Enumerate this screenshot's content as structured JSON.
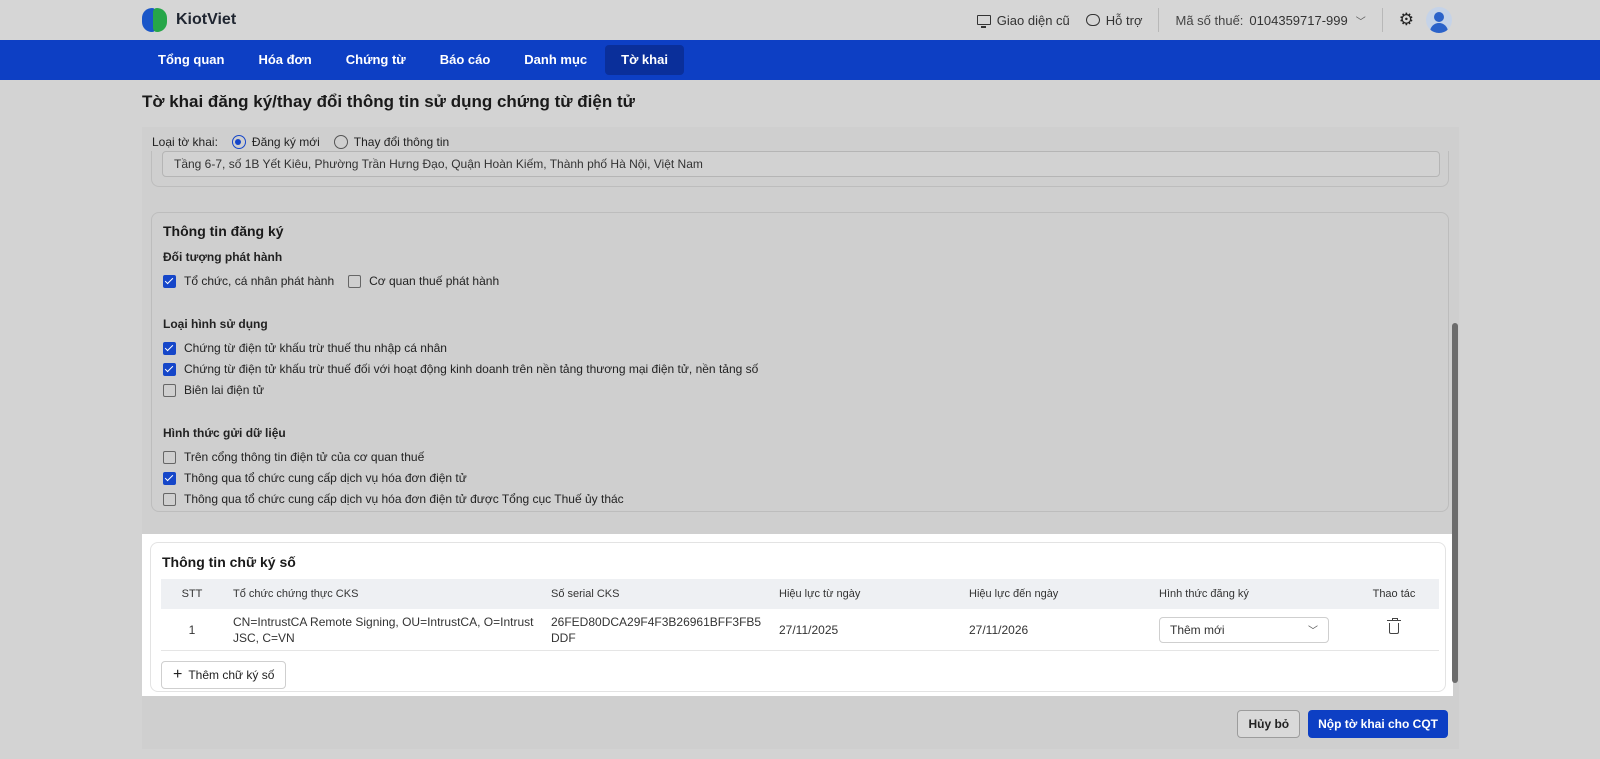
{
  "app": {
    "logo_text": "KiotViet"
  },
  "topbar": {
    "old_ui_label": "Giao diện cũ",
    "support_label": "Hỗ trợ",
    "tax_code_label": "Mã số thuế:",
    "tax_code_value": "0104359717-999"
  },
  "nav": {
    "items": [
      "Tổng quan",
      "Hóa đơn",
      "Chứng từ",
      "Báo cáo",
      "Danh mục",
      "Tờ khai"
    ],
    "active": "Tờ khai"
  },
  "page": {
    "title": "Tờ khai đăng ký/thay đổi thông tin sử dụng chứng từ điện tử"
  },
  "form": {
    "type_label": "Loại tờ khai:",
    "type_options": [
      "Đăng ký mới",
      "Thay đổi thông tin"
    ],
    "type_selected": "Đăng ký mới",
    "address_value": "Tầng 6-7, số 1B Yết Kiêu, Phường Trần Hưng Đạo, Quận Hoàn Kiếm, Thành phố Hà Nội, Việt Nam"
  },
  "registration": {
    "title": "Thông tin đăng ký",
    "issuer": {
      "title": "Đối tượng phát hành",
      "options": [
        {
          "label": "Tổ chức, cá nhân phát hành",
          "checked": true
        },
        {
          "label": "Cơ quan thuế phát hành",
          "checked": false
        }
      ]
    },
    "usage": {
      "title": "Loại hình sử dụng",
      "options": [
        {
          "label": "Chứng từ điện tử khấu trừ thuế thu nhập cá nhân",
          "checked": true
        },
        {
          "label": "Chứng từ điện tử khấu trừ thuế đối với hoạt động kinh doanh trên nền tảng thương mại điện tử, nền tảng số",
          "checked": true
        },
        {
          "label": "Biên lai điện tử",
          "checked": false
        }
      ]
    },
    "send": {
      "title": "Hình thức gửi dữ liệu",
      "options": [
        {
          "label": "Trên cổng thông tin điện tử của cơ quan thuế",
          "checked": false
        },
        {
          "label": "Thông qua tổ chức cung cấp dịch vụ hóa đơn điện tử",
          "checked": true
        },
        {
          "label": "Thông qua tổ chức cung cấp dịch vụ hóa đơn điện tử được Tổng cục Thuế ủy thác",
          "checked": false
        }
      ]
    }
  },
  "signature": {
    "title": "Thông tin chữ ký số",
    "columns": [
      "STT",
      "Tổ chức chứng thực CKS",
      "Số serial CKS",
      "Hiệu lực từ ngày",
      "Hiệu lực đến ngày",
      "Hình thức đăng ký",
      "Thao tác"
    ],
    "rows": [
      {
        "stt": "1",
        "org": "CN=IntrustCA Remote Signing, OU=IntrustCA, O=Intrust JSC, C=VN",
        "serial": "26FED80DCA29F4F3B26961BFF3FB5DDF",
        "from": "27/11/2025",
        "to": "27/11/2026",
        "type": "Thêm mới"
      }
    ],
    "add_button": "Thêm chữ ký số"
  },
  "footer": {
    "cancel": "Hủy bỏ",
    "submit": "Nộp tờ khai cho CQT"
  },
  "colors": {
    "primary": "#0d3fc4",
    "nav_active": "#0a2f9a",
    "logo_blue": "#1a56c8",
    "logo_green": "#26a649"
  }
}
